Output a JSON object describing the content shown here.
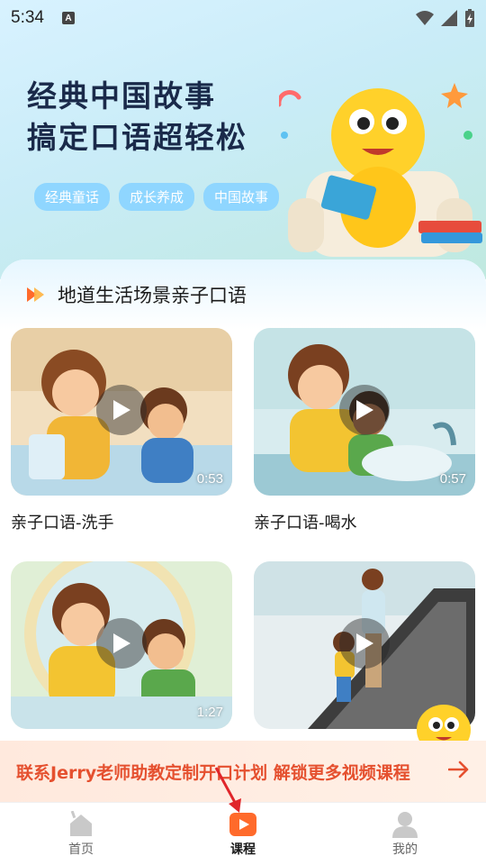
{
  "status_bar": {
    "time": "5:34",
    "a_badge": "A"
  },
  "hero": {
    "title_line1": "经典中国故事",
    "title_line2": "搞定口语超轻松",
    "tags": [
      "经典童话",
      "成长养成",
      "中国故事"
    ]
  },
  "section": {
    "title": "地道生活场景亲子口语",
    "icon": "play-arrows-icon"
  },
  "videos": [
    {
      "title": "亲子口语-洗手",
      "duration": "0:53"
    },
    {
      "title": "亲子口语-喝水",
      "duration": "0:57"
    },
    {
      "title": "",
      "duration": "1:27"
    },
    {
      "title": "",
      "duration": ""
    }
  ],
  "promo": {
    "text": "联系Jerry老师助教定制开口计划 解锁更多视频课程"
  },
  "nav": [
    {
      "label": "首页",
      "icon": "home-icon",
      "active": false
    },
    {
      "label": "课程",
      "icon": "course-play-icon",
      "active": true
    },
    {
      "label": "我的",
      "icon": "profile-icon",
      "active": false
    }
  ],
  "colors": {
    "accent": "#ff6a2b",
    "promo_text": "#e5502f",
    "tag_bg": "#8fd6ff"
  }
}
